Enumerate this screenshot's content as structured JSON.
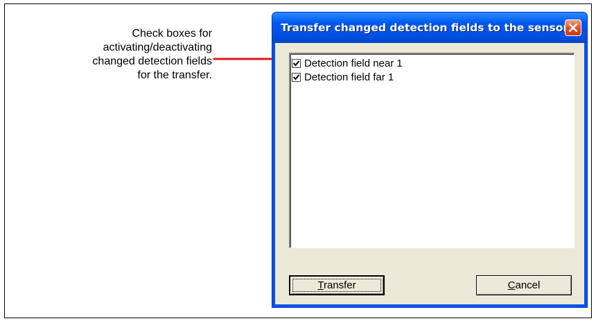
{
  "callout": {
    "lines": [
      "Check boxes for",
      "activating/deactivating",
      "changed detection fields",
      "for the transfer."
    ],
    "arrow_color": "#e0141e"
  },
  "dialog": {
    "title": "Transfer changed detection fields to the sensor",
    "close_icon": "close-icon",
    "items": [
      {
        "label": "Detection field near 1",
        "checked": true
      },
      {
        "label": "Detection field far 1",
        "checked": true
      }
    ],
    "transfer_button": {
      "mnemonic": "T",
      "rest": "ransfer"
    },
    "cancel_button": {
      "mnemonic": "C",
      "rest": "ancel"
    }
  }
}
